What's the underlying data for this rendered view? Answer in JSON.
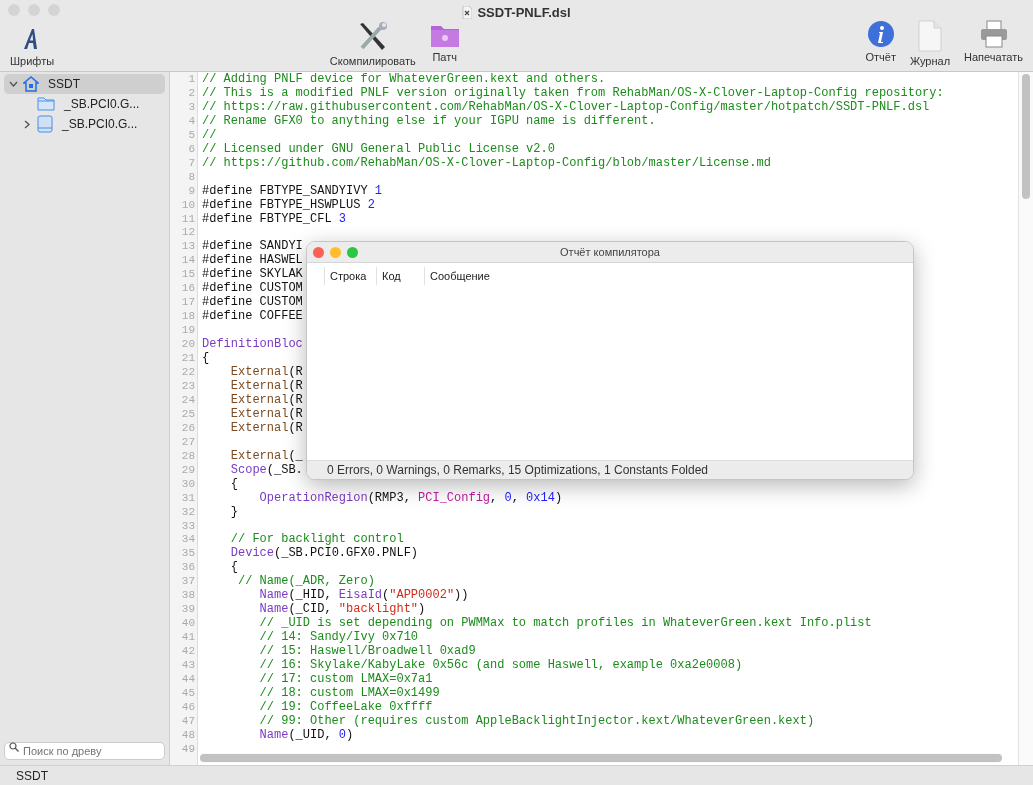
{
  "window": {
    "title": "SSDT-PNLF.dsl"
  },
  "toolbar": {
    "left": [
      {
        "kind": "font",
        "label": "Шрифты"
      }
    ],
    "center": [
      {
        "kind": "compile",
        "label": "Скомпилировать"
      },
      {
        "kind": "patch",
        "label": "Патч"
      }
    ],
    "right": [
      {
        "kind": "info",
        "label": "Отчёт"
      },
      {
        "kind": "log",
        "label": "Журнал"
      },
      {
        "kind": "print",
        "label": "Напечатать"
      }
    ]
  },
  "sidebar": {
    "items": [
      {
        "label": "SSDT",
        "kind": "root",
        "selected": true,
        "expanded": true,
        "children": [
          {
            "label": "_SB.PCI0.G...",
            "kind": "folder",
            "selected": false
          },
          {
            "label": "_SB.PCI0.G...",
            "kind": "device",
            "selected": false,
            "expanded": false
          }
        ]
      }
    ],
    "search": {
      "placeholder": "Поиск по древу"
    }
  },
  "editor": {
    "lines": [
      {
        "n": "1",
        "tokens": [
          {
            "kind": "comment",
            "text": "// Adding PNLF device for WhateverGreen.kext and others."
          }
        ]
      },
      {
        "n": "2",
        "tokens": [
          {
            "kind": "comment",
            "text": "// This is a modified PNLF version originally taken from RehabMan/OS-X-Clover-Laptop-Config repository:"
          }
        ]
      },
      {
        "n": "3",
        "tokens": [
          {
            "kind": "comment",
            "text": "// https://raw.githubusercontent.com/RehabMan/OS-X-Clover-Laptop-Config/master/hotpatch/SSDT-PNLF.dsl"
          }
        ]
      },
      {
        "n": "4",
        "tokens": [
          {
            "kind": "comment",
            "text": "// Rename GFX0 to anything else if your IGPU name is different."
          }
        ]
      },
      {
        "n": "5",
        "tokens": [
          {
            "kind": "comment",
            "text": "//"
          }
        ]
      },
      {
        "n": "6",
        "tokens": [
          {
            "kind": "comment",
            "text": "// Licensed under GNU General Public License v2.0"
          }
        ]
      },
      {
        "n": "7",
        "tokens": [
          {
            "kind": "comment",
            "text": "// https://github.com/RehabMan/OS-X-Clover-Laptop-Config/blob/master/License.md"
          }
        ]
      },
      {
        "n": "8"
      },
      {
        "n": "9",
        "tokens": [
          {
            "kind": "plain",
            "text": "#define FBTYPE_SANDYIVY "
          },
          {
            "kind": "number",
            "text": "1"
          }
        ]
      },
      {
        "n": "10",
        "tokens": [
          {
            "kind": "plain",
            "text": "#define FBTYPE_HSWPLUS "
          },
          {
            "kind": "number",
            "text": "2"
          }
        ]
      },
      {
        "n": "11",
        "tokens": [
          {
            "kind": "plain",
            "text": "#define FBTYPE_CFL "
          },
          {
            "kind": "number",
            "text": "3"
          }
        ]
      },
      {
        "n": "12"
      },
      {
        "n": "13",
        "tokens": [
          {
            "kind": "plain",
            "text": "#define SANDYI"
          }
        ]
      },
      {
        "n": "14",
        "tokens": [
          {
            "kind": "plain",
            "text": "#define HASWEL"
          }
        ]
      },
      {
        "n": "15",
        "tokens": [
          {
            "kind": "plain",
            "text": "#define SKYLAK"
          }
        ]
      },
      {
        "n": "16",
        "tokens": [
          {
            "kind": "plain",
            "text": "#define CUSTOM"
          }
        ]
      },
      {
        "n": "17",
        "tokens": [
          {
            "kind": "plain",
            "text": "#define CUSTOM"
          }
        ]
      },
      {
        "n": "18",
        "tokens": [
          {
            "kind": "plain",
            "text": "#define COFFEE"
          }
        ]
      },
      {
        "n": "19"
      },
      {
        "n": "20",
        "tokens": [
          {
            "kind": "keyword",
            "text": "DefinitionBloc"
          }
        ]
      },
      {
        "n": "21",
        "tokens": [
          {
            "kind": "plain",
            "text": "{"
          }
        ]
      },
      {
        "n": "22",
        "tokens": [
          {
            "kind": "external",
            "text": "    External"
          },
          {
            "kind": "plain",
            "text": "(R"
          }
        ]
      },
      {
        "n": "23",
        "tokens": [
          {
            "kind": "external",
            "text": "    External"
          },
          {
            "kind": "plain",
            "text": "(R"
          }
        ]
      },
      {
        "n": "24",
        "tokens": [
          {
            "kind": "external",
            "text": "    External"
          },
          {
            "kind": "plain",
            "text": "(R"
          }
        ]
      },
      {
        "n": "25",
        "tokens": [
          {
            "kind": "external",
            "text": "    External"
          },
          {
            "kind": "plain",
            "text": "(R"
          }
        ]
      },
      {
        "n": "26",
        "tokens": [
          {
            "kind": "external",
            "text": "    External"
          },
          {
            "kind": "plain",
            "text": "(R"
          }
        ]
      },
      {
        "n": "27"
      },
      {
        "n": "28",
        "tokens": [
          {
            "kind": "external",
            "text": "    External"
          },
          {
            "kind": "plain",
            "text": "(_"
          }
        ]
      },
      {
        "n": "29",
        "tokens": [
          {
            "kind": "keyword",
            "text": "    Scope"
          },
          {
            "kind": "plain",
            "text": "(_SB."
          }
        ]
      },
      {
        "n": "30",
        "tokens": [
          {
            "kind": "plain",
            "text": "    {"
          }
        ]
      },
      {
        "n": "31",
        "tokens": [
          {
            "kind": "keyword",
            "text": "        OperationRegion"
          },
          {
            "kind": "plain",
            "text": "(RMP3, "
          },
          {
            "kind": "constant",
            "text": "PCI_Config"
          },
          {
            "kind": "plain",
            "text": ", "
          },
          {
            "kind": "number",
            "text": "0"
          },
          {
            "kind": "plain",
            "text": ", "
          },
          {
            "kind": "number",
            "text": "0x14"
          },
          {
            "kind": "plain",
            "text": ")"
          }
        ]
      },
      {
        "n": "32",
        "tokens": [
          {
            "kind": "plain",
            "text": "    }"
          }
        ]
      },
      {
        "n": "33"
      },
      {
        "n": "34",
        "tokens": [
          {
            "kind": "comment",
            "text": "    // For backlight control"
          }
        ]
      },
      {
        "n": "35",
        "tokens": [
          {
            "kind": "keyword",
            "text": "    Device"
          },
          {
            "kind": "plain",
            "text": "(_SB.PCI0.GFX0.PNLF)"
          }
        ]
      },
      {
        "n": "36",
        "tokens": [
          {
            "kind": "plain",
            "text": "    {"
          }
        ]
      },
      {
        "n": "37",
        "tokens": [
          {
            "kind": "comment",
            "text": "     // Name(_ADR, Zero)"
          }
        ]
      },
      {
        "n": "38",
        "tokens": [
          {
            "kind": "keyword",
            "text": "        Name"
          },
          {
            "kind": "plain",
            "text": "(_HID, "
          },
          {
            "kind": "keyword",
            "text": "EisaId"
          },
          {
            "kind": "plain",
            "text": "("
          },
          {
            "kind": "string",
            "text": "\"APP0002\""
          },
          {
            "kind": "plain",
            "text": "))"
          }
        ]
      },
      {
        "n": "39",
        "tokens": [
          {
            "kind": "keyword",
            "text": "        Name"
          },
          {
            "kind": "plain",
            "text": "(_CID, "
          },
          {
            "kind": "string",
            "text": "\"backlight\""
          },
          {
            "kind": "plain",
            "text": ")"
          }
        ]
      },
      {
        "n": "40",
        "tokens": [
          {
            "kind": "comment",
            "text": "        // _UID is set depending on PWMMax to match profiles in WhateverGreen.kext Info.plist"
          }
        ]
      },
      {
        "n": "41",
        "tokens": [
          {
            "kind": "comment",
            "text": "        // 14: Sandy/Ivy 0x710"
          }
        ]
      },
      {
        "n": "42",
        "tokens": [
          {
            "kind": "comment",
            "text": "        // 15: Haswell/Broadwell 0xad9"
          }
        ]
      },
      {
        "n": "43",
        "tokens": [
          {
            "kind": "comment",
            "text": "        // 16: Skylake/KabyLake 0x56c (and some Haswell, example 0xa2e0008)"
          }
        ]
      },
      {
        "n": "44",
        "tokens": [
          {
            "kind": "comment",
            "text": "        // 17: custom LMAX=0x7a1"
          }
        ]
      },
      {
        "n": "45",
        "tokens": [
          {
            "kind": "comment",
            "text": "        // 18: custom LMAX=0x1499"
          }
        ]
      },
      {
        "n": "46",
        "tokens": [
          {
            "kind": "comment",
            "text": "        // 19: CoffeeLake 0xffff"
          }
        ]
      },
      {
        "n": "47",
        "tokens": [
          {
            "kind": "comment",
            "text": "        // 99: Other (requires custom AppleBacklightInjector.kext/WhateverGreen.kext)"
          }
        ]
      },
      {
        "n": "48",
        "tokens": [
          {
            "kind": "keyword",
            "text": "        Name"
          },
          {
            "kind": "plain",
            "text": "(_UID, "
          },
          {
            "kind": "number",
            "text": "0"
          },
          {
            "kind": "plain",
            "text": ")"
          }
        ]
      },
      {
        "n": "49"
      }
    ]
  },
  "report_window": {
    "title": "Отчёт компилятора",
    "columns": [
      "Строка",
      "Код",
      "Сообщение"
    ],
    "summary": "0 Errors, 0 Warnings, 0 Remarks, 15 Optimizations, 1 Constants Folded"
  },
  "status_bar": {
    "text": "SSDT"
  }
}
